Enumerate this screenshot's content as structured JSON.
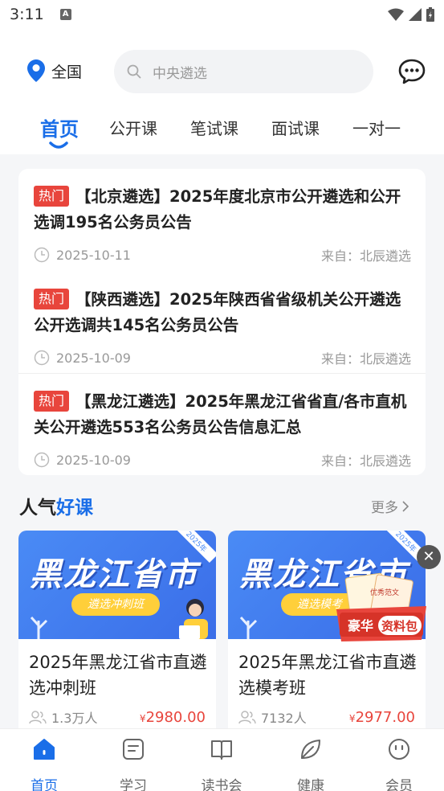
{
  "status_bar": {
    "time": "3:11",
    "notif": "A"
  },
  "header": {
    "location": "全国",
    "search_placeholder": "中央遴选",
    "tabs": [
      "首页",
      "公开课",
      "笔试课",
      "面试课",
      "一对一"
    ]
  },
  "news": [
    {
      "badge": "热门",
      "title": "【北京遴选】2025年度北京市公开遴选和公开选调195名公务员公告",
      "date": "2025-10-11",
      "source": "来自：北辰遴选"
    },
    {
      "badge": "热门",
      "title": "【陕西遴选】2025年陕西省省级机关公开遴选公开选调共145名公务员公告",
      "date": "2025-10-09",
      "source": "来自：北辰遴选"
    },
    {
      "badge": "热门",
      "title": "【黑龙江遴选】2025年黑龙江省省直/各市直机关公开遴选553名公务员公告信息汇总",
      "date": "2025-10-09",
      "source": "来自：北辰遴选"
    }
  ],
  "section": {
    "title_a": "人气",
    "title_b": "好课",
    "more": "更多"
  },
  "courses": [
    {
      "banner_title": "黑龙江省市",
      "banner_tag": "遴选冲刺班",
      "banner_year": "2025年",
      "title": "2025年黑龙江省市直遴选冲刺班",
      "students": "1.3万人",
      "currency": "¥",
      "price": "2980.00"
    },
    {
      "banner_title": "黑龙江省市",
      "banner_tag": "遴选模考",
      "banner_year": "2025年",
      "title": "2025年黑龙江省市直遴选模考班",
      "students": "7132人",
      "currency": "¥",
      "price": "2977.00"
    }
  ],
  "gift": {
    "label_a": "豪华",
    "label_b": "资料包",
    "note": "优秀范文"
  },
  "bottom_nav": [
    "首页",
    "学习",
    "读书会",
    "健康",
    "会员"
  ],
  "colors": {
    "accent": "#1a6ee8",
    "hot": "#e8453c",
    "price": "#e8453c"
  }
}
